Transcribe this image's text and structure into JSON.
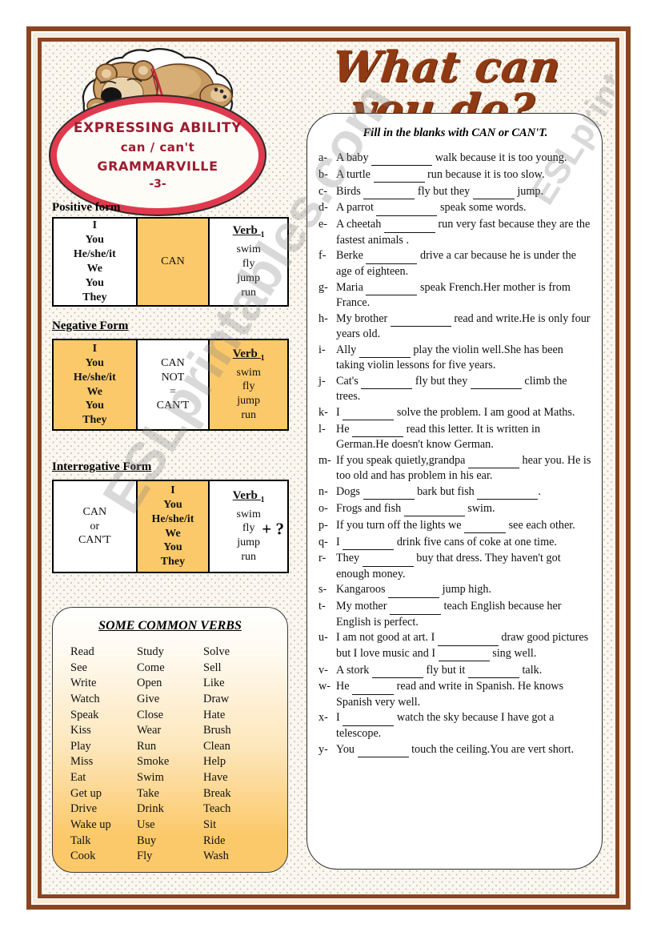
{
  "title": "What can you do?",
  "logo": {
    "line1": "EXPRESSING ABILITY",
    "line2": "can / can't",
    "line3": "GRAMMARVILLE",
    "line4": "-3-",
    "ring_color": "#e03a4e",
    "text_color": "#9e1b2f"
  },
  "watermark": {
    "diagonal": "ESLprintables.com",
    "side": "ESLprintables.com"
  },
  "accent": {
    "orange": "#fcc96a",
    "frame_brown": "#8a4520",
    "title_brown": "#8f3a13"
  },
  "tables": [
    {
      "label": "Positive form",
      "cells": [
        {
          "fill": "white",
          "bold": true,
          "lines": [
            "I",
            "You",
            "He/she/it",
            "We",
            "You",
            "They"
          ]
        },
        {
          "fill": "orange",
          "bold": false,
          "lines": [
            "CAN"
          ]
        },
        {
          "fill": "white",
          "bold": false,
          "header": "Verb",
          "header_sub": "1",
          "lines": [
            "swim",
            "fly",
            "jump",
            "run"
          ]
        }
      ]
    },
    {
      "label": "Negative Form",
      "cells": [
        {
          "fill": "orange",
          "bold": true,
          "lines": [
            "I",
            "You",
            "He/she/it",
            "We",
            "You",
            "They"
          ]
        },
        {
          "fill": "white",
          "bold": false,
          "lines": [
            "CAN",
            "NOT",
            "=",
            "CAN'T"
          ]
        },
        {
          "fill": "orange",
          "bold": false,
          "header": "Verb",
          "header_sub": "1",
          "lines": [
            "swim",
            "fly",
            "jump",
            "run"
          ]
        }
      ]
    },
    {
      "label": "Interrogative Form",
      "cells": [
        {
          "fill": "white",
          "bold": false,
          "lines": [
            "CAN",
            "or",
            "CAN'T"
          ]
        },
        {
          "fill": "orange",
          "bold": true,
          "lines": [
            "I",
            "You",
            "He/she/it",
            "We",
            "You",
            "They"
          ]
        },
        {
          "fill": "white",
          "bold": false,
          "header": "Verb",
          "header_sub": "1",
          "lines": [
            "swim",
            "fly",
            "jump",
            "run"
          ],
          "suffix": "+ ?"
        }
      ]
    }
  ],
  "verbs_panel": {
    "title": "SOME COMMON VERBS",
    "columns": [
      [
        "Read",
        "See",
        "Write",
        "Watch",
        "Speak",
        "Kiss",
        "Play",
        "Miss",
        "Eat",
        "Get up",
        "Drive",
        "Wake up",
        "Talk",
        "Cook"
      ],
      [
        "Study",
        "Come",
        "Open",
        "Give",
        "Close",
        "Wear",
        "Run",
        "Smoke",
        "Swim",
        "Take",
        "Drink",
        "Use",
        "Buy",
        "Fly"
      ],
      [
        "Solve",
        "Sell",
        "Like",
        "Draw",
        "Hate",
        "Brush",
        "Clean",
        "Help",
        "Have",
        "Break",
        "Teach",
        "Sit",
        "Ride",
        "Wash"
      ]
    ]
  },
  "exercise": {
    "title": "Fill in the blanks with CAN or CAN'T.",
    "items": [
      {
        "mark": "a-",
        "parts": [
          "A baby ",
          "_l_",
          " walk because it is too young."
        ]
      },
      {
        "mark": "b-",
        "parts": [
          "A turtle ",
          "_m_",
          " run because it is too slow."
        ]
      },
      {
        "mark": "c-",
        "parts": [
          "Birds ",
          "_m_",
          " fly but they ",
          "_s_",
          " jump."
        ]
      },
      {
        "mark": "d-",
        "parts": [
          "A parrot ",
          "_l_",
          " speak some words."
        ]
      },
      {
        "mark": "e-",
        "parts": [
          "A cheetah ",
          "_m_",
          " run very fast because they are the fastest animals ."
        ]
      },
      {
        "mark": "f-",
        "parts": [
          "Berke ",
          "_m_",
          " drive a car because he is under the age of eighteen."
        ]
      },
      {
        "mark": "g-",
        "parts": [
          "Maria ",
          "_m_",
          " speak French.Her mother is from France."
        ]
      },
      {
        "mark": "h-",
        "parts": [
          "My brother ",
          "_l_",
          " read and write.He is only four years old."
        ]
      },
      {
        "mark": "i-",
        "parts": [
          "Ally ",
          "_m_",
          " play the violin well.She has been  taking violin lessons for five years."
        ]
      },
      {
        "mark": "j-",
        "parts": [
          "Cat's ",
          "_m_",
          " fly but they ",
          "_m_",
          " climb the trees."
        ]
      },
      {
        "mark": "k-",
        "parts": [
          "I ",
          "_m_",
          " solve the problem. I am good at Maths."
        ]
      },
      {
        "mark": "l-",
        "parts": [
          "He ",
          "_m_",
          " read this letter. It is written in German.He doesn't know German."
        ]
      },
      {
        "mark": "m-",
        "parts": [
          "If you speak quietly,grandpa ",
          "_m_",
          " hear you. He is too old and has problem in his ear."
        ]
      },
      {
        "mark": "n-",
        "parts": [
          "Dogs ",
          "_m_",
          " bark but fish ",
          "_l_",
          "."
        ]
      },
      {
        "mark": "o-",
        "parts": [
          "Frogs and fish ",
          "_l_",
          " swim."
        ]
      },
      {
        "mark": "p-",
        "parts": [
          "If you turn off the lights we ",
          "_s_",
          " see each other."
        ]
      },
      {
        "mark": "q-",
        "parts": [
          "I ",
          "_m_",
          " drink five cans of coke at one time."
        ]
      },
      {
        "mark": "r-",
        "parts": [
          "They ",
          "_m_",
          " buy that dress. They haven't got enough money."
        ]
      },
      {
        "mark": "s-",
        "parts": [
          "Kangaroos ",
          "_m_",
          " jump high."
        ]
      },
      {
        "mark": "t-",
        "parts": [
          "My mother ",
          "_m_",
          " teach English because her English is perfect."
        ]
      },
      {
        "mark": "u-",
        "parts": [
          "I am not good at art. I ",
          "_l_",
          " draw good pictures but I love music and I ",
          "_m_",
          " sing well."
        ]
      },
      {
        "mark": "v-",
        "parts": [
          "A stork ",
          "_m_",
          " fly but it ",
          "_m_",
          " talk."
        ]
      },
      {
        "mark": "w-",
        "parts": [
          "He ",
          "_s_",
          " read and write in Spanish. He knows Spanish very well."
        ]
      },
      {
        "mark": "x-",
        "parts": [
          "I ",
          "_m_",
          " watch the sky because I have got a telescope."
        ]
      },
      {
        "mark": "y-",
        "parts": [
          "You ",
          "_m_",
          " touch the ceiling.You are vert short."
        ]
      }
    ]
  }
}
